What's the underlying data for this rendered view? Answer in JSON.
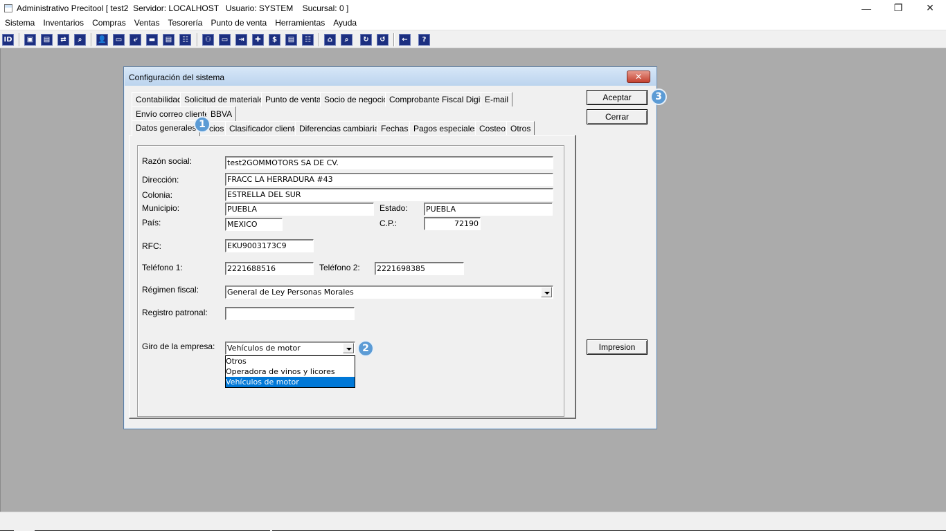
{
  "window": {
    "title": "Administrativo Precitool [ test2  Servidor: LOCALHOST   Usuario: SYSTEM    Sucursal: 0 ]",
    "controls": [
      "—",
      "❐",
      "✕"
    ]
  },
  "menu": [
    "Sistema",
    "Inventarios",
    "Compras",
    "Ventas",
    "Tesorería",
    "Punto de venta",
    "Herramientas",
    "Ayuda"
  ],
  "toolbar": {
    "glyphs": [
      "ID",
      "▣",
      "▤",
      "⇄",
      "⌕",
      "👤",
      "▭",
      "⤶",
      "▬",
      "▤",
      "☷",
      "⚇",
      "▭",
      "⇥",
      "✚",
      "$",
      "▤",
      "☷",
      "⌂",
      "⌕",
      "↻",
      "↺",
      "←",
      "?"
    ]
  },
  "dialog": {
    "title": "Configuración del sistema",
    "close": "✕",
    "tabs_row1": [
      "Contabilidad",
      "Solicitud de materiales",
      "Punto de venta",
      "Socio de negocio",
      "Comprobante Fiscal Digital",
      "E-mail"
    ],
    "tabs_row2": [
      "Envío correo cliente",
      "BBVA"
    ],
    "tabs_row3": [
      "Datos generales",
      "cios",
      "Clasificador cliente",
      "Diferencias cambiarias",
      "Fechas",
      "Pagos especiales",
      "Costeo",
      "Otros"
    ],
    "form": {
      "razon_social_label": "Razón social:",
      "razon_social": "test2GOMMOTORS SA DE CV.",
      "direccion_label": "Dirección:",
      "direccion": "FRACC LA HERRADURA #43",
      "colonia_label": "Colonia:",
      "colonia": "ESTRELLA DEL SUR",
      "municipio_label": "Municipio:",
      "municipio": "PUEBLA",
      "estado_label": "Estado:",
      "estado": "PUEBLA",
      "pais_label": "País:",
      "pais": "MEXICO",
      "cp_label": "C.P.:",
      "cp": "72190",
      "rfc_label": "RFC:",
      "rfc": "EKU9003173C9",
      "telefono1_label": "Teléfono 1:",
      "telefono1": "2221688516",
      "telefono2_label": "Teléfono 2:",
      "telefono2": "2221698385",
      "regimen_label": "Régimen fiscal:",
      "regimen": "General de Ley Personas Morales",
      "registro_label": "Registro patronal:",
      "registro": "",
      "giro_label": "Giro de la empresa:",
      "giro": "Vehículos de motor",
      "giro_options": [
        "Otros",
        "Operadora de vinos y licores",
        "Vehículos de motor"
      ]
    },
    "buttons": {
      "aceptar": "Aceptar",
      "cerrar": "Cerrar",
      "impresion": "Impresion"
    }
  },
  "badges": [
    "1",
    "2",
    "3"
  ]
}
